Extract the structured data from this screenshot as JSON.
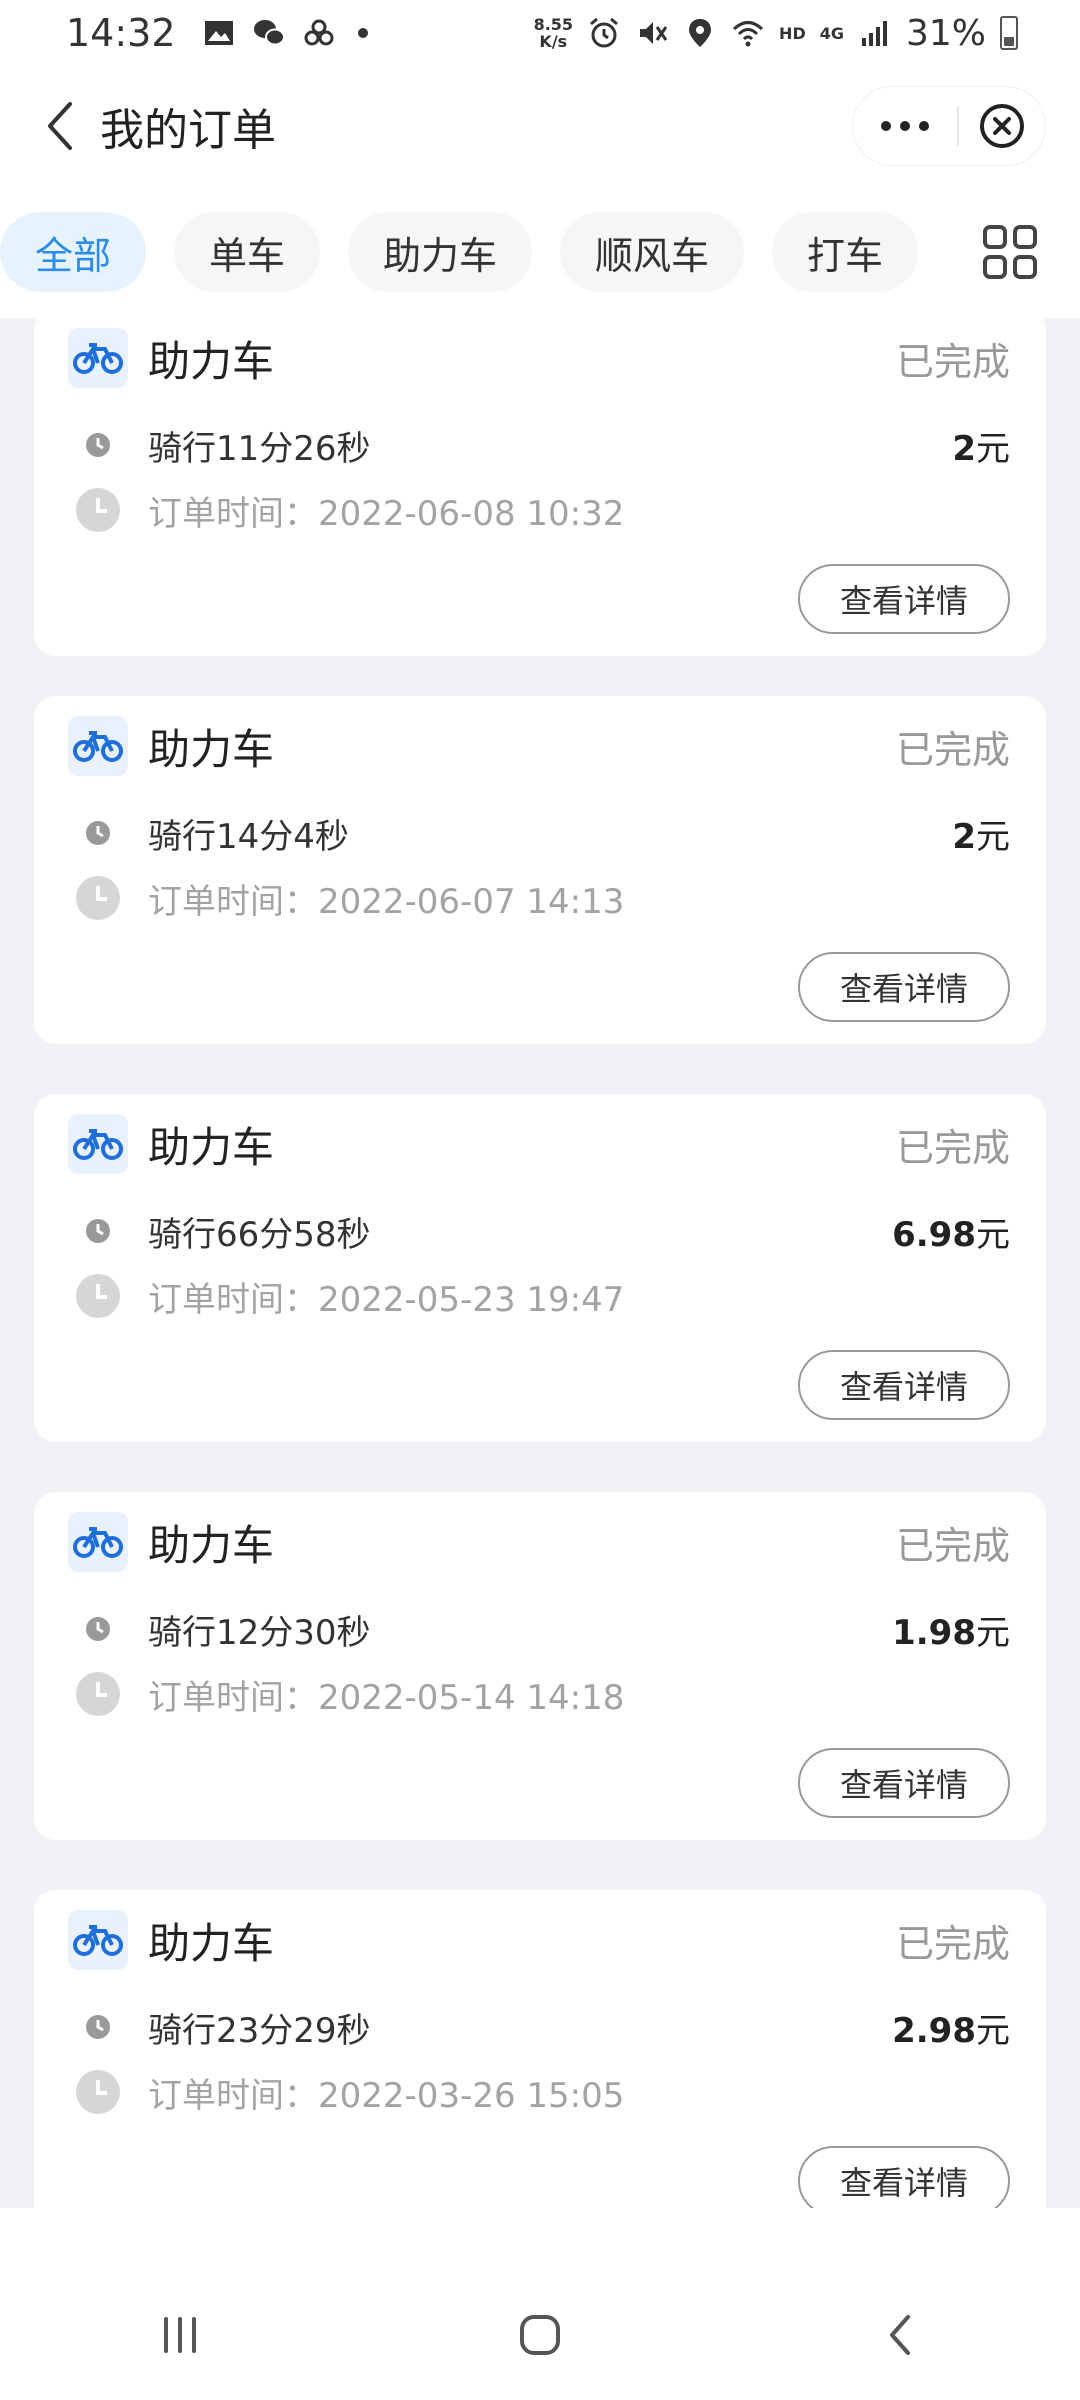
{
  "status_bar": {
    "time": "14:32",
    "net_speed_value": "8.55",
    "net_speed_unit": "K/s",
    "hd": "HD",
    "network": "4G",
    "battery": "31%"
  },
  "header": {
    "title": "我的订单"
  },
  "tabs": [
    {
      "label": "全部",
      "active": true
    },
    {
      "label": "单车",
      "active": false
    },
    {
      "label": "助力车",
      "active": false
    },
    {
      "label": "顺风车",
      "active": false
    },
    {
      "label": "打车",
      "active": false
    }
  ],
  "orders": [
    {
      "type": "助力车",
      "status": "已完成",
      "duration": "骑行11分26秒",
      "price": "2",
      "currency": "元",
      "order_time": "订单时间：2022-06-08 10:32",
      "detail_label": "查看详情"
    },
    {
      "type": "助力车",
      "status": "已完成",
      "duration": "骑行14分4秒",
      "price": "2",
      "currency": "元",
      "order_time": "订单时间：2022-06-07 14:13",
      "detail_label": "查看详情"
    },
    {
      "type": "助力车",
      "status": "已完成",
      "duration": "骑行66分58秒",
      "price": "6.98",
      "currency": "元",
      "order_time": "订单时间：2022-05-23 19:47",
      "detail_label": "查看详情"
    },
    {
      "type": "助力车",
      "status": "已完成",
      "duration": "骑行12分30秒",
      "price": "1.98",
      "currency": "元",
      "order_time": "订单时间：2022-05-14 14:18",
      "detail_label": "查看详情"
    },
    {
      "type": "助力车",
      "status": "已完成",
      "duration": "骑行23分29秒",
      "price": "2.98",
      "currency": "元",
      "order_time": "订单时间：2022-03-26 15:05",
      "detail_label": "查看详情"
    }
  ],
  "icons": {
    "back": "back-arrow-icon",
    "more": "more-dots-icon",
    "close": "close-circle-icon",
    "grid": "grid-icon",
    "bike": "bike-icon",
    "clock": "clock-icon"
  },
  "colors": {
    "accent": "#2a8be8",
    "active_tab_bg": "#e6f3fd",
    "list_bg": "#f0f2f6",
    "status_gray": "#999999"
  }
}
